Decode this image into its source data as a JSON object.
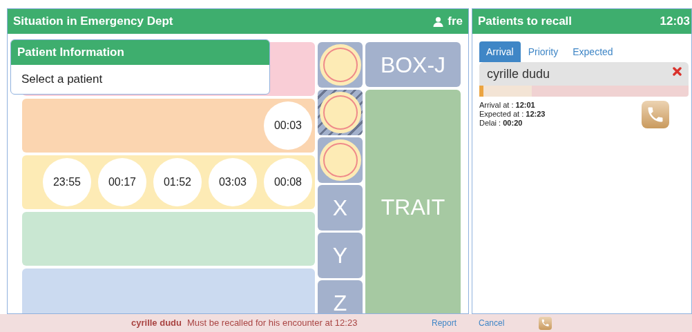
{
  "main_panel": {
    "title": "Situation in Emergency Dept",
    "user": "fre"
  },
  "patient_info": {
    "title": "Patient Information",
    "text": "Select a patient"
  },
  "lanes": [
    {
      "color": "#f9cdd6"
    },
    {
      "color": "#fbd5b0",
      "timers": [
        "00:03"
      ]
    },
    {
      "color": "#fdebb5",
      "timers": [
        "23:55",
        "00:17",
        "01:52",
        "03:03",
        "00:08"
      ]
    },
    {
      "color": "#c9e7d2"
    },
    {
      "color": "#cbdaf0"
    }
  ],
  "small_tiles": [
    {
      "kind": "circle",
      "hatched": false
    },
    {
      "kind": "circle",
      "hatched": true
    },
    {
      "kind": "circle",
      "hatched": false
    },
    {
      "kind": "letter",
      "label": "X"
    },
    {
      "kind": "letter",
      "label": "Y"
    },
    {
      "kind": "letter",
      "label": "Z"
    }
  ],
  "big_tiles": [
    {
      "label": "BOX-J",
      "color": "#a3b1cc"
    },
    {
      "label": "TRAIT",
      "color": "#a6c9a2"
    }
  ],
  "recall_panel": {
    "title": "Patients to recall",
    "time": "12:03",
    "tabs": [
      {
        "label": "Arrival",
        "selected": true
      },
      {
        "label": "Priority",
        "selected": false
      },
      {
        "label": "Expected",
        "selected": false
      }
    ],
    "patients": [
      {
        "name": "cyrille dudu",
        "level": 0.25,
        "details": [
          "Arrival at : **12:01**",
          "Expected at : **12:23**",
          "Delai : **00:20**"
        ]
      }
    ]
  },
  "status_bar": {
    "name": "cyrille dudu",
    "message": "Must be recalled for his encounter at 12:23",
    "links": [
      "Report",
      "Cancel"
    ]
  }
}
